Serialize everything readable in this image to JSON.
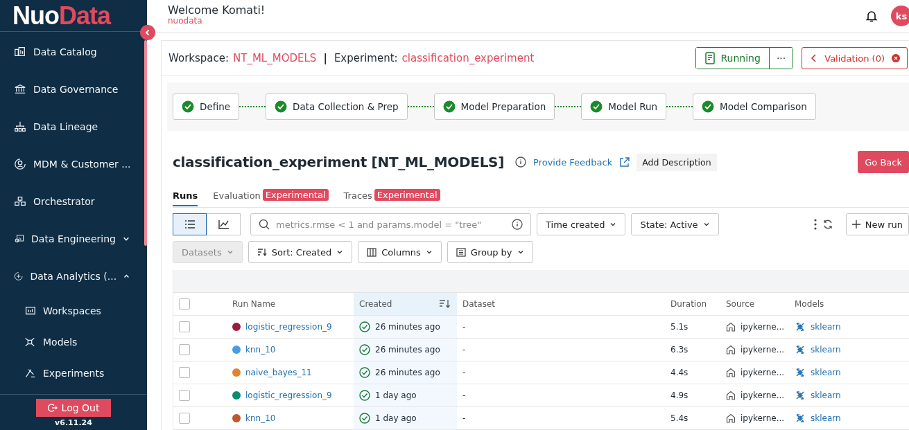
{
  "sidebar": {
    "logo": {
      "part_1": "Nuo",
      "part_2": "Data"
    },
    "items": [
      {
        "label": "Data Catalog",
        "kind": "catalog"
      },
      {
        "label": "Data Governance",
        "kind": "bank"
      },
      {
        "label": "Data Lineage",
        "kind": "tree"
      },
      {
        "label": "MDM & Customer ...",
        "kind": "mdm"
      },
      {
        "label": "Orchestrator",
        "kind": "orchestrator"
      },
      {
        "label": "Data Engineering",
        "kind": "engineering",
        "expanded": false
      },
      {
        "label": "Data Analytics (...",
        "kind": "analytics",
        "expanded": true,
        "children": [
          {
            "label": "Workspaces",
            "kind": "workspace"
          },
          {
            "label": "Models",
            "kind": "models"
          },
          {
            "label": "Experiments",
            "kind": "experiments"
          }
        ]
      }
    ],
    "logout": "Log Out",
    "version": "v6.11.24"
  },
  "header": {
    "welcome": "Welcome Komati!",
    "org": "nuodata",
    "avatar": "ks"
  },
  "breadcrumb": {
    "workspace_label": "Workspace:",
    "workspace": "NT_ML_MODELS",
    "separator": "|",
    "experiment_label": "Experiment:",
    "experiment": "classification_experiment",
    "status": "Running",
    "more": "···",
    "validation": "Validation (0)"
  },
  "steps": [
    {
      "label": "Define",
      "done": true
    },
    {
      "label": "Data Collection & Prep",
      "done": true
    },
    {
      "label": "Model Preparation",
      "done": true
    },
    {
      "label": "Model Run",
      "done": true
    },
    {
      "label": "Model Comparison",
      "done": true
    }
  ],
  "title": "classification_experiment [NT_ML_MODELS]",
  "feedback": "Provide Feedback",
  "add_description": "Add Description",
  "go_back": "Go Back",
  "tabs": [
    {
      "label": "Runs",
      "selected": true
    },
    {
      "label": "Evaluation",
      "badge": "Experimental",
      "selected": false
    },
    {
      "label": "Traces",
      "badge": "Experimental",
      "selected": false
    }
  ],
  "toolbar": {
    "views": [
      {
        "kind": "list",
        "selected": true
      },
      {
        "kind": "chart",
        "selected": false
      }
    ],
    "search_placeholder": "metrics.rmse < 1 and params.model = \"tree\"",
    "time": "Time created",
    "state": "State: Active",
    "new_run": "New run",
    "datasets": "Datasets",
    "datasets_disabled": true,
    "sort": "Sort: Created",
    "columns": "Columns",
    "group_by": "Group by"
  },
  "table": {
    "select_all_checked": false,
    "columns": [
      "Run Name",
      "Created",
      "Dataset",
      "Duration",
      "Source",
      "Models"
    ],
    "rows": [
      {
        "color": "#9b1c3c",
        "name": "logistic_regression_9",
        "created": "26 minutes ago",
        "dataset": "-",
        "duration": "5.1s",
        "source": "ipykerne...",
        "model": "sklearn",
        "selected": false
      },
      {
        "color": "#4a9be0",
        "name": "knn_10",
        "created": "26 minutes ago",
        "dataset": "-",
        "duration": "6.3s",
        "source": "ipykerne...",
        "model": "sklearn",
        "selected": false
      },
      {
        "color": "#e0852e",
        "name": "naive_bayes_11",
        "created": "26 minutes ago",
        "dataset": "-",
        "duration": "4.4s",
        "source": "ipykerne...",
        "model": "sklearn",
        "selected": false
      },
      {
        "color": "#0e8a6e",
        "name": "logistic_regression_9",
        "created": "1 day ago",
        "dataset": "-",
        "duration": "4.9s",
        "source": "ipykerne...",
        "model": "sklearn",
        "selected": false
      },
      {
        "color": "#c0562a",
        "name": "knn_10",
        "created": "1 day ago",
        "dataset": "-",
        "duration": "5.4s",
        "source": "ipykerne...",
        "model": "sklearn",
        "selected": false
      }
    ]
  }
}
